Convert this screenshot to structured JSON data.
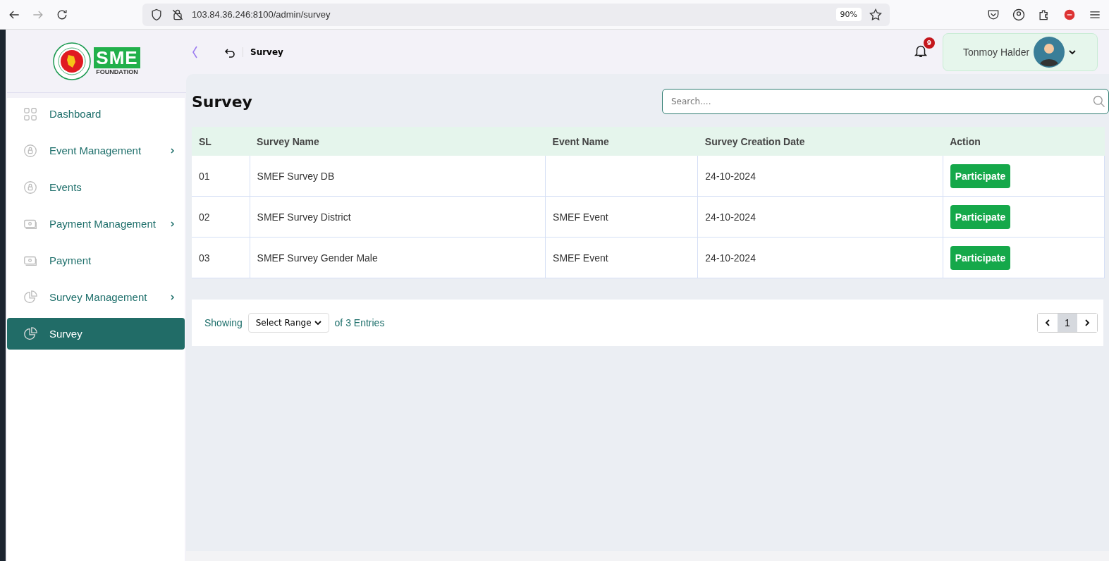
{
  "browser": {
    "url": "103.84.36.246:8100/admin/survey",
    "zoom": "90%"
  },
  "sidebar": {
    "items": [
      {
        "label": "Dashboard",
        "kind": "grid",
        "expandable": false,
        "selected": false
      },
      {
        "label": "Event Management",
        "kind": "lock",
        "expandable": true,
        "selected": false
      },
      {
        "label": "Events",
        "kind": "lock",
        "expandable": false,
        "selected": false
      },
      {
        "label": "Payment Management",
        "kind": "money",
        "expandable": true,
        "selected": false
      },
      {
        "label": "Payment",
        "kind": "money",
        "expandable": false,
        "selected": false
      },
      {
        "label": "Survey Management",
        "kind": "pie",
        "expandable": true,
        "selected": false
      },
      {
        "label": "Survey",
        "kind": "pie",
        "expandable": false,
        "selected": true
      }
    ]
  },
  "logo": {
    "text": "SME",
    "subtitle": "FOUNDATION"
  },
  "header": {
    "breadcrumb": "Survey",
    "notifications": "9",
    "user": "Tonmoy Halder"
  },
  "page": {
    "title": "Survey",
    "search": {
      "placeholder": "Search...."
    }
  },
  "table": {
    "columns": [
      "SL",
      "Survey Name",
      "Event Name",
      "Survey Creation Date",
      "Action"
    ],
    "rows": [
      {
        "sl": "01",
        "survey": "SMEF Survey DB",
        "event": "",
        "date": "24-10-2024",
        "action": "Participate"
      },
      {
        "sl": "02",
        "survey": "SMEF Survey District",
        "event": "SMEF Event",
        "date": "24-10-2024",
        "action": "Participate"
      },
      {
        "sl": "03",
        "survey": "SMEF Survey Gender Male",
        "event": "SMEF Event",
        "date": "24-10-2024",
        "action": "Participate"
      }
    ]
  },
  "pagination": {
    "showing": "Showing",
    "range": "Select Range",
    "entries": "of 3 Entries",
    "pages": [
      {
        "label": "1",
        "selected": true
      }
    ]
  }
}
